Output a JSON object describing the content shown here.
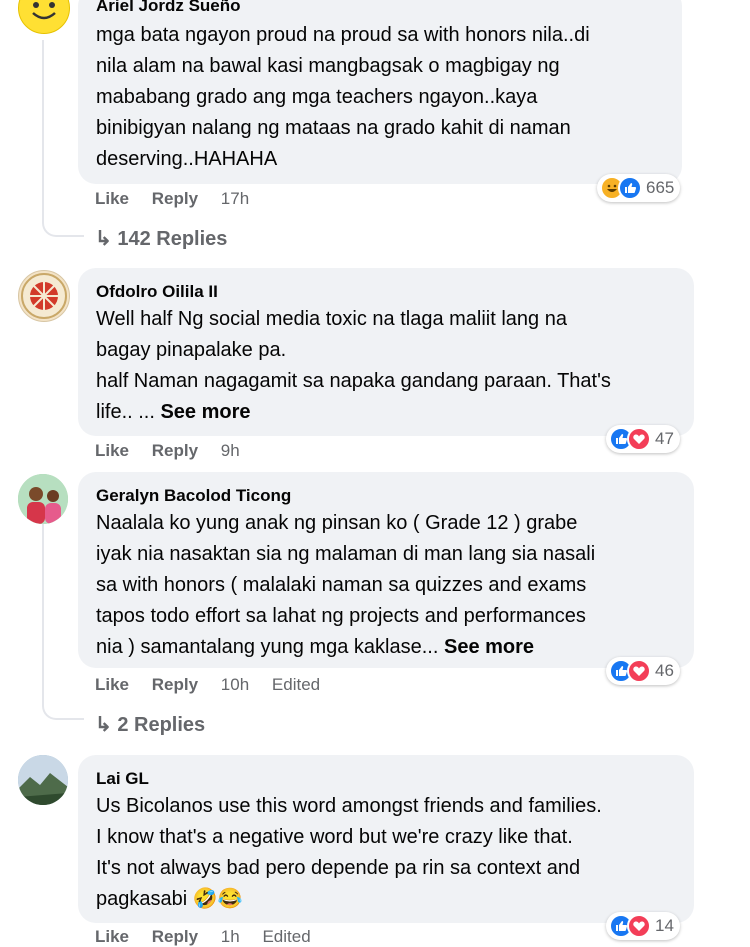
{
  "colors": {
    "like_blue": "#1877f2",
    "love_red": "#f33e58",
    "haha_yellow": "#f7b125",
    "meta_gray": "#65676b",
    "bubble_bg": "#f0f2f5"
  },
  "comments": [
    {
      "author": "Ariel Jordz Sueño",
      "text": "mga bata ngayon proud na proud sa with honors nila..di\nnila alam na bawal kasi mangbagsak o magbigay ng\nmababang grado ang mga teachers ngayon..kaya\nbinibigyan nalang ng mataas na grado kahit di naman\ndeserving..HAHAHA",
      "like": "Like",
      "reply": "Reply",
      "time": "17h",
      "reactions": [
        "haha-icon",
        "like-icon"
      ],
      "reaction_count": "665",
      "replies": "142 Replies"
    },
    {
      "author": "Ofdolro Oilila II",
      "text": "Well half Ng social media toxic na tlaga maliit lang na\nbagay pinapalake pa.\nhalf Naman nagagamit sa napaka gandang paraan. That's\nlife.. ...",
      "see_more": "See more",
      "like": "Like",
      "reply": "Reply",
      "time": "9h",
      "reactions": [
        "like-icon",
        "love-icon"
      ],
      "reaction_count": "47"
    },
    {
      "author": "Geralyn Bacolod Ticong",
      "text": "Naalala ko yung anak ng pinsan ko ( Grade 12 ) grabe\niyak nia nasaktan sia ng malaman di man lang sia nasali\nsa with honors ( malalaki naman sa quizzes and exams\ntapos todo effort sa lahat ng projects and performances\nnia ) samantalang yung mga kaklase...",
      "see_more": "See more",
      "like": "Like",
      "reply": "Reply",
      "time": "10h",
      "edited": "Edited",
      "reactions": [
        "like-icon",
        "love-icon"
      ],
      "reaction_count": "46",
      "replies": "2 Replies"
    },
    {
      "author": "Lai GL",
      "text": "Us Bicolanos use this word amongst friends and families.\nI know that's a negative word but we're crazy like that.\nIt's not always bad pero depende pa rin sa context and\npagkasabi",
      "emoji": "🤣😂",
      "like": "Like",
      "reply": "Reply",
      "time": "1h",
      "edited": "Edited",
      "reactions": [
        "like-icon",
        "love-icon"
      ],
      "reaction_count": "14"
    }
  ]
}
